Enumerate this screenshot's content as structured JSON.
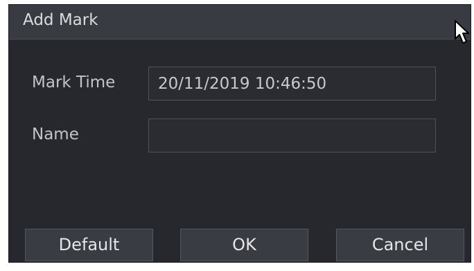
{
  "dialog": {
    "title": "Add Mark"
  },
  "form": {
    "mark_time": {
      "label": "Mark Time",
      "value": "20/11/2019 10:46:50"
    },
    "name": {
      "label": "Name",
      "value": "",
      "placeholder": ""
    }
  },
  "buttons": {
    "default_label": "Default",
    "ok_label": "OK",
    "cancel_label": "Cancel"
  },
  "icons": {
    "cursor": "mouse-pointer-icon"
  },
  "colors": {
    "dialog_bg": "#27282d",
    "titlebar_bg": "#383b42",
    "button_bg": "#393c43",
    "field_border": "#4f5258"
  }
}
